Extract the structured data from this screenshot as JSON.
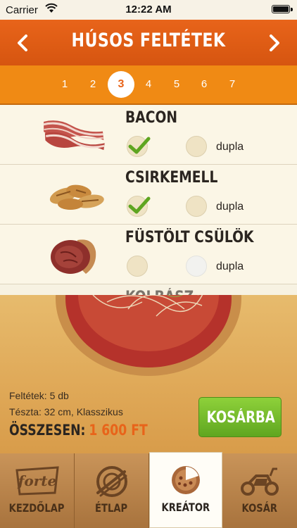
{
  "status": {
    "carrier": "Carrier",
    "time": "12:22 AM"
  },
  "header": {
    "title": "HÚSOS FELTÉTEK"
  },
  "steps": [
    "1",
    "2",
    "3",
    "4",
    "5",
    "6",
    "7"
  ],
  "active_step": "3",
  "toppings": [
    {
      "name": "BACON",
      "dupla": "dupla",
      "selected": true,
      "double_enabled": true
    },
    {
      "name": "CSIRKEMELL",
      "dupla": "dupla",
      "selected": true,
      "double_enabled": true
    },
    {
      "name": "FÜSTÖLT CSÜLÖK",
      "dupla": "dupla",
      "selected": false,
      "double_enabled": false
    },
    {
      "name": "KOLBÁSZ"
    }
  ],
  "summary": {
    "toppings_line": "Feltétek:  5 db",
    "dough_line": "Tészta:  32 cm, Klasszikus",
    "total_label": "ÖSSZESEN:",
    "total_value": "1 600 FT",
    "cart_button": "KOSÁRBA"
  },
  "tabs": [
    {
      "label": "KEZDŐLAP",
      "icon": "forte-logo-icon"
    },
    {
      "label": "ÉTLAP",
      "icon": "plate-cutlery-icon"
    },
    {
      "label": "KREÁTOR",
      "icon": "pizza-icon",
      "active": true
    },
    {
      "label": "KOSÁR",
      "icon": "scooter-icon"
    }
  ],
  "colors": {
    "accent": "#e8641a",
    "step_bar": "#f08a14",
    "cart_green": "#6cb52a"
  }
}
